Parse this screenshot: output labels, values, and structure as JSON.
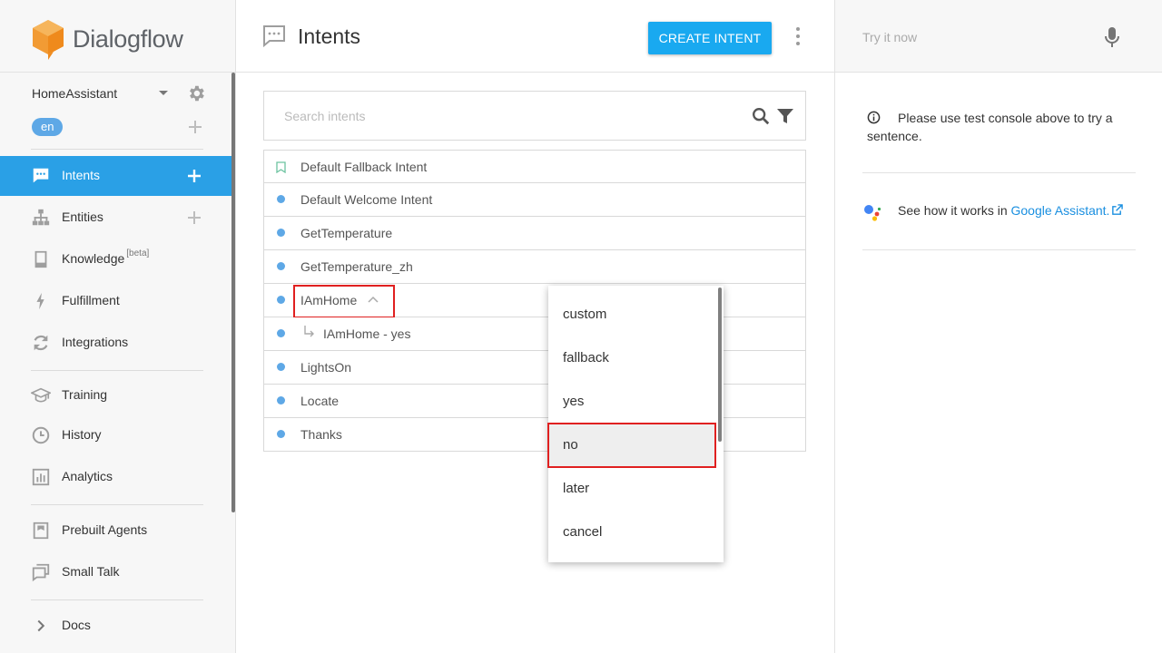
{
  "brand": {
    "name": "Dialogflow"
  },
  "agent": {
    "name": "HomeAssistant",
    "language": "en"
  },
  "nav": [
    {
      "id": "intents",
      "label": "Intents",
      "icon": "chat-icon",
      "active": true,
      "has_add": true
    },
    {
      "id": "entities",
      "label": "Entities",
      "icon": "sitemap-icon",
      "has_add": true
    },
    {
      "id": "knowledge",
      "label": "Knowledge",
      "badge": "[beta]",
      "icon": "book-icon"
    },
    {
      "id": "fulfillment",
      "label": "Fulfillment",
      "icon": "bolt-icon"
    },
    {
      "id": "integrations",
      "label": "Integrations",
      "icon": "sync-icon"
    },
    {
      "id": "training",
      "label": "Training",
      "icon": "graduation-cap-icon"
    },
    {
      "id": "history",
      "label": "History",
      "icon": "clock-icon"
    },
    {
      "id": "analytics",
      "label": "Analytics",
      "icon": "bar-chart-icon"
    },
    {
      "id": "prebuilt",
      "label": "Prebuilt Agents",
      "icon": "agent-book-icon"
    },
    {
      "id": "smalltalk",
      "label": "Small Talk",
      "icon": "chat-bubbles-icon"
    },
    {
      "id": "docs",
      "label": "Docs",
      "icon": "chevron-right-icon"
    }
  ],
  "header": {
    "title": "Intents",
    "create_label": "CREATE INTENT"
  },
  "search": {
    "placeholder": "Search intents"
  },
  "intents": [
    {
      "name": "Default Fallback Intent",
      "marker": "bookmark"
    },
    {
      "name": "Default Welcome Intent",
      "marker": "dot"
    },
    {
      "name": "GetTemperature",
      "marker": "dot"
    },
    {
      "name": "GetTemperature_zh",
      "marker": "dot"
    },
    {
      "name": "IAmHome",
      "marker": "dot",
      "expanded": true
    },
    {
      "name": "IAmHome - yes",
      "marker": "dot",
      "child": true
    },
    {
      "name": "LightsOn",
      "marker": "dot"
    },
    {
      "name": "Locate",
      "marker": "dot"
    },
    {
      "name": "Thanks",
      "marker": "dot"
    }
  ],
  "followup_menu": {
    "items": [
      "custom",
      "fallback",
      "yes",
      "no",
      "later",
      "cancel"
    ],
    "selected": "no"
  },
  "test_console": {
    "placeholder": "Try it now",
    "info": "Please use test console above to try a sentence.",
    "ga_prefix": "See how it works in ",
    "ga_link": "Google Assistant."
  },
  "colors": {
    "accent": "#19a9f0",
    "active_nav": "#2aa0e6",
    "dot": "#5ea8e6",
    "highlight": "#e02020"
  }
}
